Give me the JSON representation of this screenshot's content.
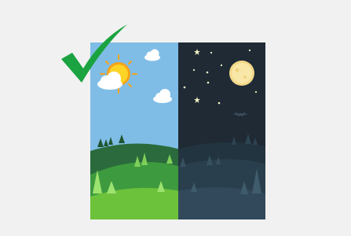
{
  "scene": {
    "background": "#f1f1f1",
    "selected": true,
    "check_icon": "checkmark-icon",
    "day_side": {
      "sky_color": "#7fbde6",
      "sun_icon": "sun-icon",
      "clouds": 3,
      "hill_colors": [
        "#2a6a3c",
        "#3d9a3f",
        "#6cc23a"
      ]
    },
    "night_side": {
      "sky_color": "#1f2a35",
      "moon_icon": "moon-icon",
      "bat_icon": "bat-icon",
      "stars": 10,
      "hill_colors": [
        "#22343f",
        "#2a3f4d",
        "#31495a"
      ]
    }
  }
}
